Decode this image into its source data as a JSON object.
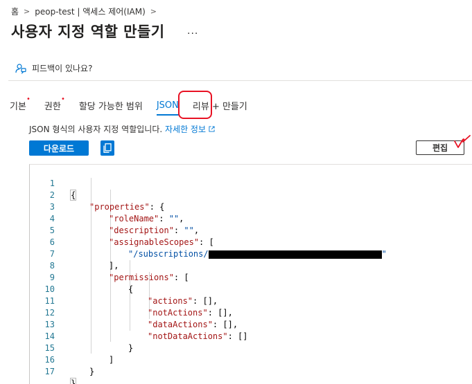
{
  "breadcrumb": {
    "home": "홈",
    "item": "peop-test | 액세스 제어(IAM)",
    "sep": ">"
  },
  "header": {
    "title": "사용자 지정 역할 만들기",
    "more": "..."
  },
  "feedback": {
    "label": "피드백이 있나요?"
  },
  "tabs": [
    {
      "label": "기본",
      "required": "•"
    },
    {
      "label": "권한",
      "required": "•"
    },
    {
      "label": "할당 가능한 범위"
    },
    {
      "label": "JSON"
    },
    {
      "label": "리뷰 + 만들기"
    }
  ],
  "description": {
    "text": "JSON 형식의 사용자 지정 역할입니다.",
    "link": "자세한 정보"
  },
  "toolbar": {
    "download": "다운로드",
    "edit": "편집"
  },
  "editor": {
    "line_numbers": [
      "1",
      "2",
      "3",
      "4",
      "5",
      "6",
      "7",
      "8",
      "9",
      "10",
      "11",
      "12",
      "13",
      "14",
      "15",
      "16",
      "17"
    ],
    "l1": "{",
    "l2_key": "\"properties\"",
    "l2_rest": ": {",
    "l3_key": "\"roleName\"",
    "l3_sep": ": ",
    "l3_val": "\"\"",
    "l3_end": ",",
    "l4_key": "\"description\"",
    "l4_sep": ": ",
    "l4_val": "\"\"",
    "l4_end": ",",
    "l5_key": "\"assignableScopes\"",
    "l5_rest": ": [",
    "l6_val": "\"/subscriptions/",
    "l6_end": "\"",
    "l7": "],",
    "l8_key": "\"permissions\"",
    "l8_rest": ": [",
    "l9": "{",
    "l10_key": "\"actions\"",
    "l10_rest": ": [],",
    "l11_key": "\"notActions\"",
    "l11_rest": ": [],",
    "l12_key": "\"dataActions\"",
    "l12_rest": ": [],",
    "l13_key": "\"notDataActions\"",
    "l13_rest": ": []",
    "l14": "}",
    "l15": "]",
    "l16": "}",
    "l17": "}"
  },
  "colors": {
    "accent": "#0078d4",
    "annotation": "#e81123",
    "json_key": "#a31515",
    "line_number": "#237893"
  }
}
